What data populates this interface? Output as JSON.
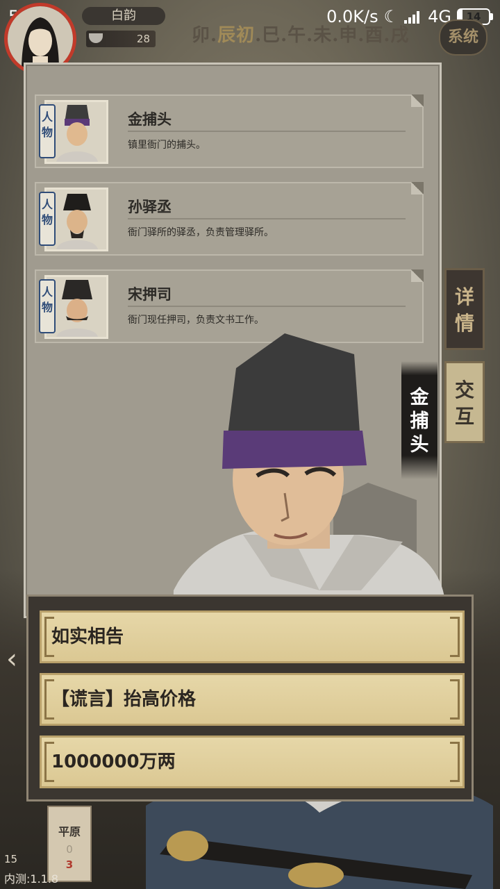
{
  "status_bar": {
    "time": "5:55",
    "net_speed": "0.0K/s",
    "network": "4G",
    "battery": "14"
  },
  "player": {
    "name": "白韵",
    "bowl_count": "28"
  },
  "time_strip": {
    "prefix": "卯.",
    "current": "辰初",
    "suffix": ".巳.午.未.申.酉.戌"
  },
  "system_button": "系统",
  "people_tag": "人物",
  "characters": [
    {
      "name": "金捕头",
      "desc": "镇里衙门的捕头。"
    },
    {
      "name": "孙驿丞",
      "desc": "衙门驿所的驿丞，负责管理驿所。"
    },
    {
      "name": "宋押司",
      "desc": "衙门现任押司，负责文书工作。"
    }
  ],
  "tabs": {
    "detail": "详情",
    "interact": "交互"
  },
  "speaker_name": "金捕头",
  "dialog_options": [
    "如实相告",
    "【谎言】抬高价格",
    "1000000万两"
  ],
  "region": {
    "name": "平原",
    "count_a": "0",
    "count_b": "3"
  },
  "side_number": "15",
  "version": "内测:1.1.8"
}
